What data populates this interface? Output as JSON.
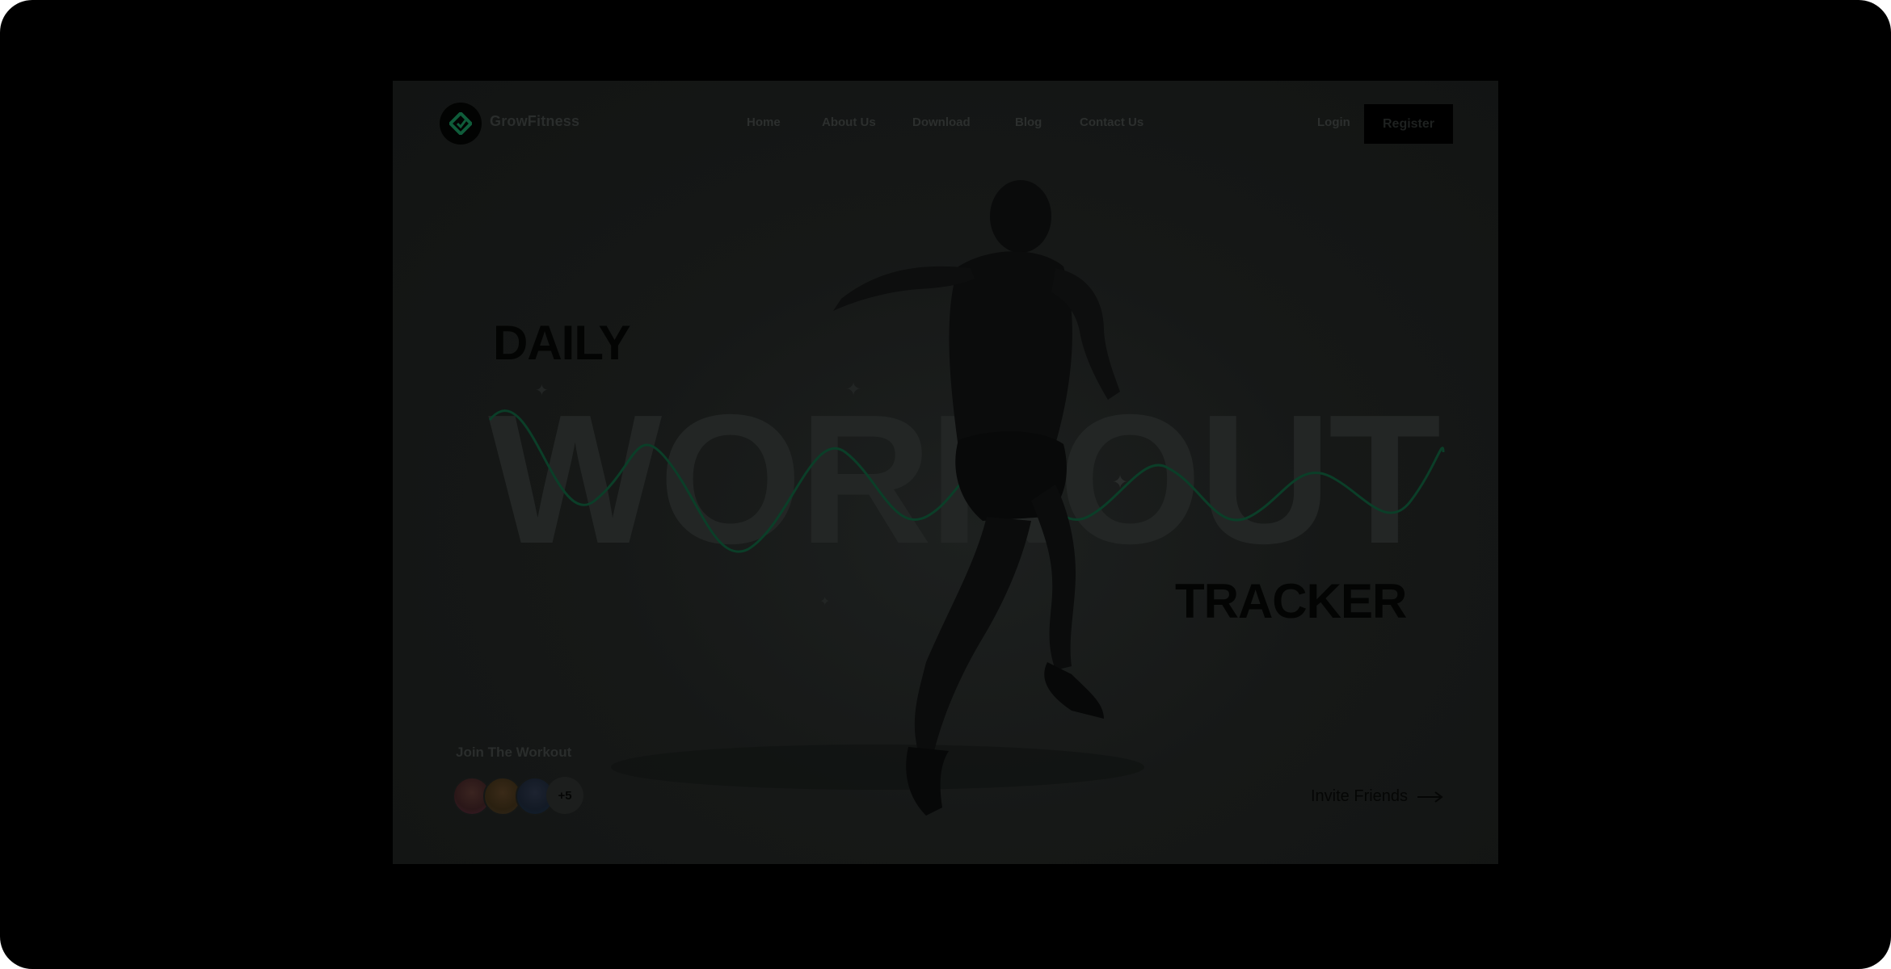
{
  "brand": {
    "name": "GrowFitness"
  },
  "nav": {
    "items": [
      "Home",
      "About Us",
      "Download",
      "Blog",
      "Contact Us"
    ],
    "login": "Login",
    "register": "Register"
  },
  "hero": {
    "daily": "DAILY",
    "workout": "WORKOUT",
    "tracker": "TRACKER",
    "join_label": "Join The Workout",
    "more_count": "+5",
    "invite": "Invite Friends"
  },
  "colors": {
    "accent": "#0f5c3a",
    "background": "#000000"
  }
}
